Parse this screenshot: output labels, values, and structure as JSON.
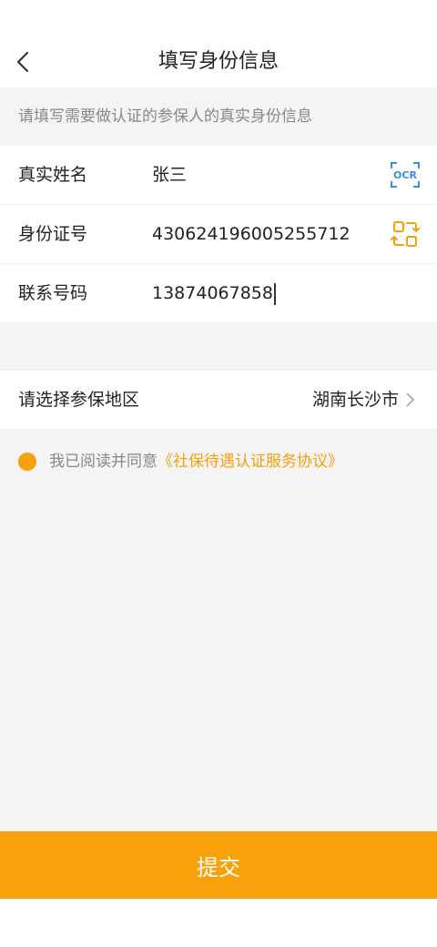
{
  "header": {
    "title": "填写身份信息",
    "back_icon": "chevron-left-icon"
  },
  "hint": "请填写需要做认证的参保人的真实身份信息",
  "form": {
    "name_label": "真实姓名",
    "name_value": "张三",
    "id_label": "身份证号",
    "id_value": "430624196005255712",
    "phone_label": "联系号码",
    "phone_value": "13874067858"
  },
  "region": {
    "label": "请选择参保地区",
    "value": "湖南长沙市"
  },
  "agreement": {
    "prefix": "我已阅读并同意",
    "link": "《社保待遇认证服务协议》"
  },
  "submit_label": "提交",
  "colors": {
    "accent": "#f9a10a",
    "ocr_blue": "#3b8fd8",
    "scan_orange": "#f5a20a"
  }
}
